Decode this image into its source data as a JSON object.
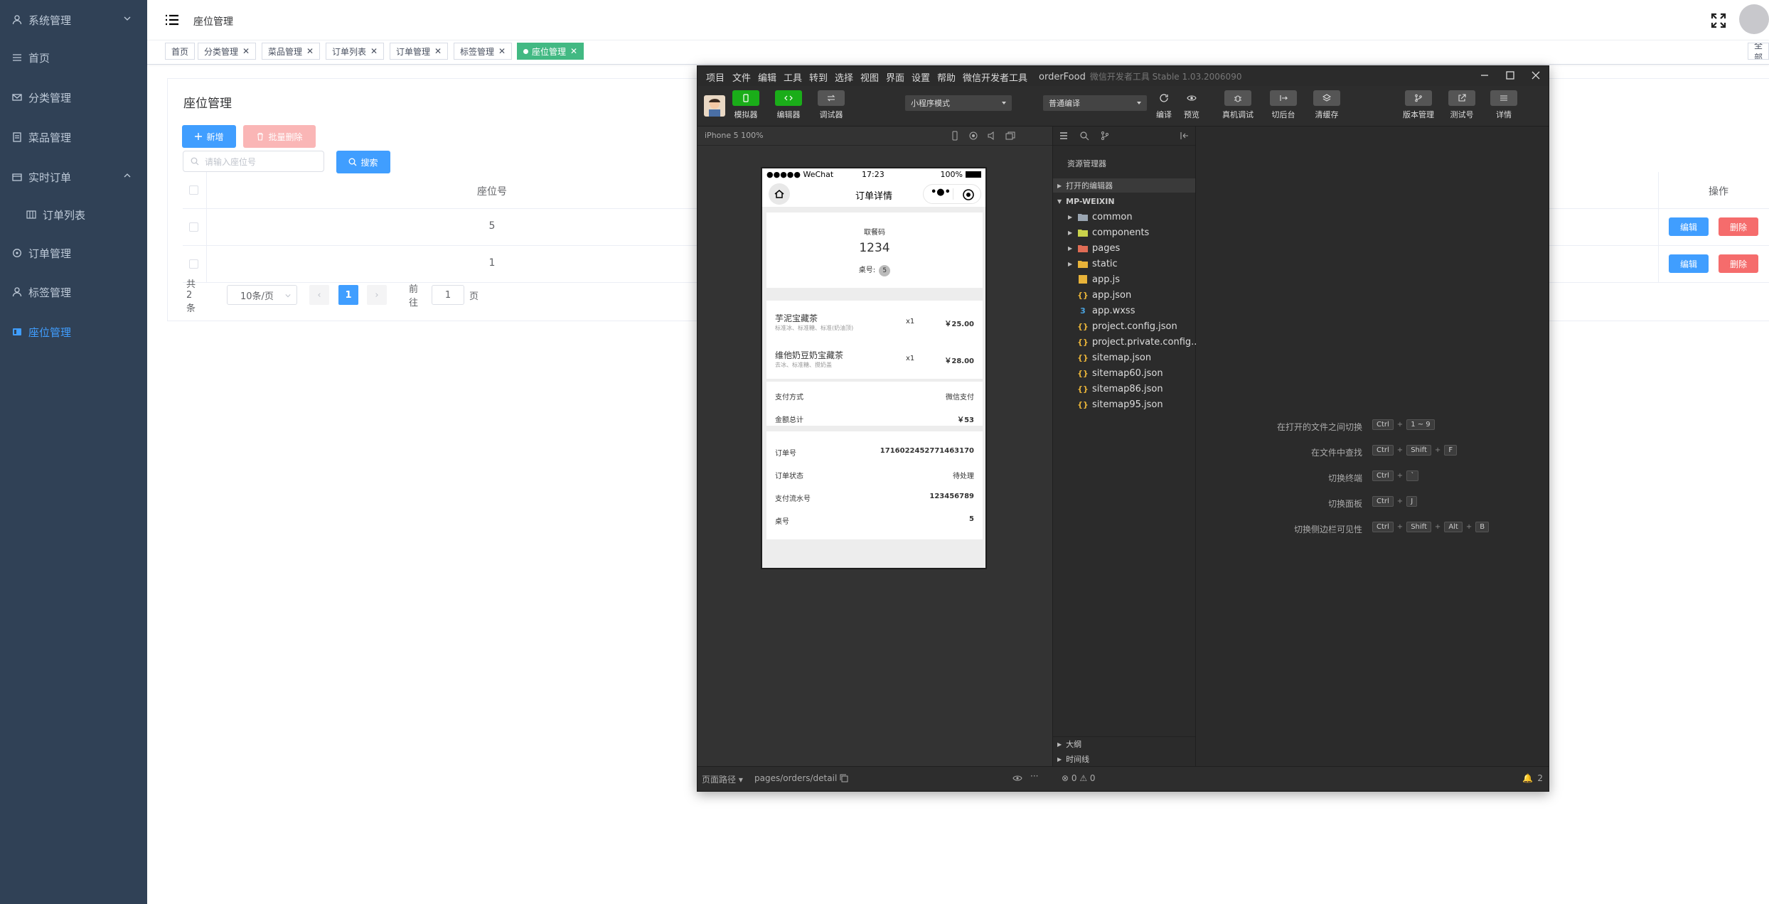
{
  "sidebar": {
    "items": [
      {
        "label": "系统管理",
        "icon": "user-icon"
      },
      {
        "label": "首页",
        "icon": "list-icon"
      },
      {
        "label": "分类管理",
        "icon": "mail-icon"
      },
      {
        "label": "菜品管理",
        "icon": "document-icon"
      },
      {
        "label": "实时订单",
        "icon": "grid-icon"
      },
      {
        "label": "订单列表",
        "icon": "table-icon"
      },
      {
        "label": "订单管理",
        "icon": "refresh-icon"
      },
      {
        "label": "标签管理",
        "icon": "user-icon"
      },
      {
        "label": "座位管理",
        "icon": "seat-icon"
      }
    ],
    "active_color": "#409eff",
    "background": "#304156"
  },
  "navbar": {
    "breadcrumb": "座位管理"
  },
  "tags": {
    "items": [
      "首页",
      "分类管理",
      "菜品管理",
      "订单列表",
      "订单管理",
      "标签管理",
      "座位管理"
    ],
    "active": "座位管理",
    "right_label": "全部"
  },
  "page": {
    "title": "座位管理",
    "add_button": "新增",
    "batch_delete_button": "批量删除",
    "search_placeholder": "请输入座位号",
    "search_button": "搜索",
    "table": {
      "columns": [
        "座位号",
        "操作"
      ],
      "rows": [
        {
          "seat": "5",
          "edit": "编辑",
          "delete": "删除"
        },
        {
          "seat": "1",
          "edit": "编辑",
          "delete": "删除"
        }
      ]
    },
    "pagination": {
      "total": "共 2 条",
      "page_size": "10条/页",
      "current_page": "1",
      "goto_label": "前往",
      "goto_value": "1",
      "page_suffix": "页"
    }
  },
  "devtools": {
    "menu": [
      "项目",
      "文件",
      "编辑",
      "工具",
      "转到",
      "选择",
      "视图",
      "界面",
      "设置",
      "帮助",
      "微信开发者工具"
    ],
    "project_name": "orderFood",
    "app_version": "微信开发者工具 Stable 1.03.2006090",
    "toolbar": {
      "simulator": "模拟器",
      "editor": "编辑器",
      "debugger": "调试器",
      "mode_select": "小程序模式",
      "compile_select": "普通编译",
      "compile": "编译",
      "preview": "预览",
      "real_debug": "真机调试",
      "background": "切后台",
      "clear_cache": "清缓存",
      "version_mgmt": "版本管理",
      "test_account": "测试号",
      "details": "详情"
    },
    "simulator": {
      "device": "iPhone 5 100%",
      "phone": {
        "carrier": "●●●●● WeChat",
        "time": "17:23",
        "battery": "100%",
        "page_title": "订单详情",
        "pickup_label": "取餐码",
        "pickup_code": "1234",
        "seat_label": "桌号:",
        "seat_value": "5",
        "items": [
          {
            "name": "芋泥宝藏茶",
            "spec": "标准冰、标准糖、标准(奶油顶)",
            "qty": "x1",
            "price": "￥25.00"
          },
          {
            "name": "维他奶豆奶宝藏茶",
            "spec": "去冰、标准糖、搅奶盖",
            "qty": "x1",
            "price": "￥28.00"
          }
        ],
        "payment_method_label": "支付方式",
        "payment_method": "微信支付",
        "total_label": "金额总计",
        "total": "￥53",
        "order_no_label": "订单号",
        "order_no": "1716022452771463170",
        "status_label": "订单状态",
        "status": "待处理",
        "serial_label": "支付流水号",
        "serial": "123456789",
        "table_label": "桌号",
        "table": "5"
      }
    },
    "explorer": {
      "title": "资源管理器",
      "open_editors": "打开的编辑器",
      "root": "MP-WEIXIN",
      "files": [
        {
          "name": "common",
          "type": "folder",
          "color": "#9aa5b1"
        },
        {
          "name": "components",
          "type": "folder",
          "color": "#c9d24b"
        },
        {
          "name": "pages",
          "type": "folder",
          "color": "#e06c55"
        },
        {
          "name": "static",
          "type": "folder",
          "color": "#e8b339"
        },
        {
          "name": "app.js",
          "type": "js",
          "color": "#e8b339"
        },
        {
          "name": "app.json",
          "type": "json",
          "color": "#e8b339"
        },
        {
          "name": "app.wxss",
          "type": "css",
          "color": "#4aa3df"
        },
        {
          "name": "project.config.json",
          "type": "json",
          "color": "#e8b339"
        },
        {
          "name": "project.private.config...",
          "type": "json",
          "color": "#e8b339"
        },
        {
          "name": "sitemap.json",
          "type": "json",
          "color": "#e8b339"
        },
        {
          "name": "sitemap60.json",
          "type": "json",
          "color": "#e8b339"
        },
        {
          "name": "sitemap86.json",
          "type": "json",
          "color": "#e8b339"
        },
        {
          "name": "sitemap95.json",
          "type": "json",
          "color": "#e8b339"
        }
      ],
      "outline": "大纲",
      "timeline": "时间线"
    },
    "shortcuts": [
      {
        "label": "在打开的文件之间切换",
        "keys": [
          "Ctrl",
          "1 ~ 9"
        ]
      },
      {
        "label": "在文件中查找",
        "keys": [
          "Ctrl",
          "Shift",
          "F"
        ]
      },
      {
        "label": "切换终端",
        "keys": [
          "Ctrl",
          "`"
        ]
      },
      {
        "label": "切换面板",
        "keys": [
          "Ctrl",
          "J"
        ]
      },
      {
        "label": "切换侧边栏可见性",
        "keys": [
          "Ctrl",
          "Shift",
          "Alt",
          "B"
        ]
      }
    ],
    "status_bar": {
      "page_path_label": "页面路径",
      "page_path": "pages/orders/detail",
      "errors": "0",
      "warnings": "0",
      "notifications": "2"
    }
  }
}
